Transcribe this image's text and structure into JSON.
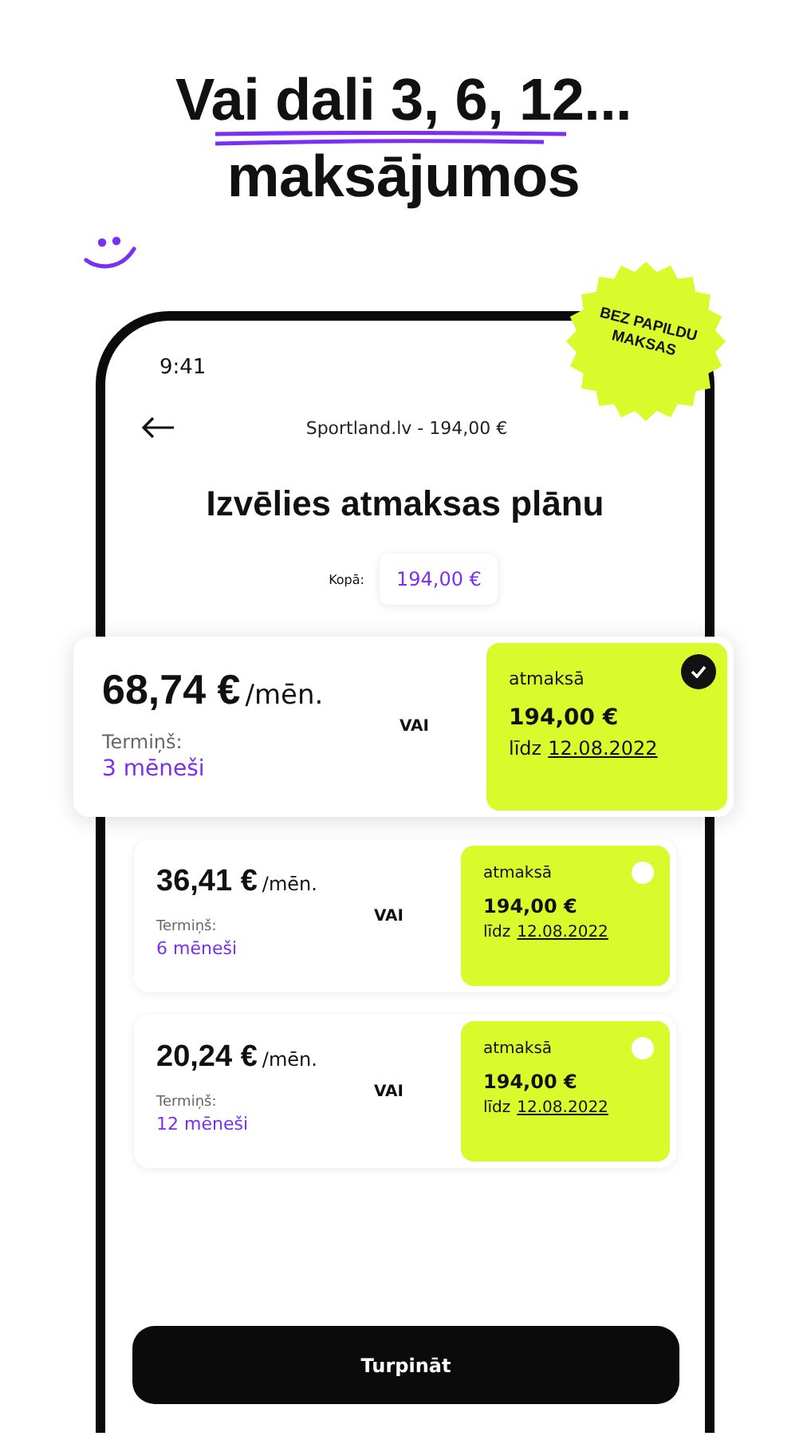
{
  "headline": {
    "lines": [
      "Vai dali 3, 6, 12...",
      "maksājumos"
    ]
  },
  "badge": {
    "text": "BEZ PAPILDU MAKSAS"
  },
  "phone": {
    "status_time": "9:41",
    "nav_title": "Sportland.lv - 194,00 €",
    "heading": "Izvēlies atmaksas plānu",
    "total_label": "Kopā:",
    "total_value": "194,00 €",
    "plans": [
      {
        "price": "68,74 €",
        "unit": "/mēn.",
        "term_label": "Termiņš:",
        "term": "3 mēneši",
        "or": "VAI",
        "full_label": "atmaksā",
        "full_amount": "194,00 €",
        "until": "līdz",
        "date": "12.08.2022",
        "selected": true
      },
      {
        "price": "36,41 €",
        "unit": "/mēn.",
        "term_label": "Termiņš:",
        "term": "6 mēneši",
        "or": "VAI",
        "full_label": "atmaksā",
        "full_amount": "194,00 €",
        "until": "līdz",
        "date": "12.08.2022",
        "selected": false
      },
      {
        "price": "20,24 €",
        "unit": "/mēn.",
        "term_label": "Termiņš:",
        "term": "12 mēneši",
        "or": "VAI",
        "full_label": "atmaksā",
        "full_amount": "194,00 €",
        "until": "līdz",
        "date": "12.08.2022",
        "selected": false
      }
    ],
    "continue_button": "Turpināt"
  }
}
